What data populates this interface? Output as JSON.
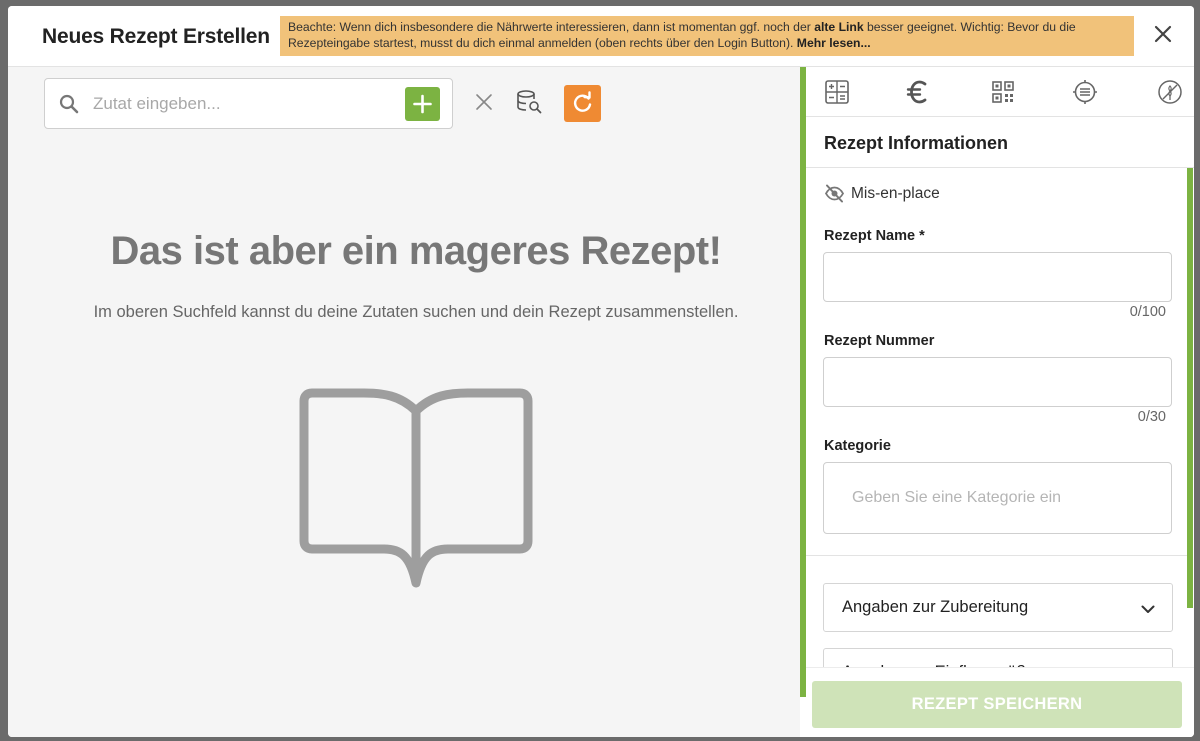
{
  "modal": {
    "title": "Neues Rezept Erstellen",
    "notice": {
      "text_before": "Beachte: Wenn dich insbesondere die Nährwerte interessieren, dann ist momentan ggf. noch der ",
      "link_alt": "alte Link",
      "text_middle": " besser geeignet. Wichtig: Bevor du die Rezepteingabe startest, musst du dich einmal anmelden (oben rechts über den Login Button). ",
      "link_more": "Mehr lesen...",
      "background": "#f1c27a"
    },
    "close_icon": "close-icon"
  },
  "search": {
    "placeholder": "Zutat eingeben...",
    "add_icon": "plus-icon",
    "clear_icon": "close-icon",
    "database_icon": "database-search-icon",
    "refresh_icon": "refresh-icon"
  },
  "empty_state": {
    "title": "Das ist aber ein mageres Rezept!",
    "subtitle": "Im oberen Suchfeld kannst du deine Zutaten suchen und dein Rezept zusammenstellen.",
    "icon": "open-book-icon"
  },
  "side_tabs": [
    {
      "icon": "calculator-icon"
    },
    {
      "icon": "euro-icon"
    },
    {
      "icon": "qr-code-icon"
    },
    {
      "icon": "target-list-icon"
    },
    {
      "icon": "wheat-icon"
    }
  ],
  "recipe_info": {
    "title": "Rezept Informationen",
    "mise_en_place": "Mis-en-place",
    "name_label": "Rezept Name *",
    "name_value": "",
    "name_counter": "0/100",
    "number_label": "Rezept Nummer",
    "number_value": "",
    "number_counter": "0/30",
    "category_label": "Kategorie",
    "category_placeholder": "Geben Sie eine Kategorie ein",
    "accordion_1": "Angaben zur Zubereitung",
    "accordion_2": "Angaben zu Einflussgrößen"
  },
  "footer": {
    "save_label": "REZEPT SPEICHERN"
  },
  "colors": {
    "accent_green": "#7cb342",
    "accent_orange": "#ef8a33",
    "save_disabled": "#cfe3b8"
  }
}
